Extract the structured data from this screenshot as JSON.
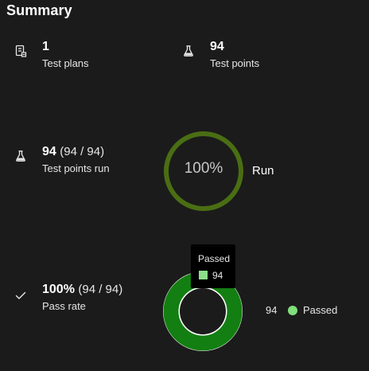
{
  "summary": {
    "title": "Summary",
    "test_plans": {
      "value": "1",
      "label": "Test plans",
      "icon": "test-plan-icon"
    },
    "test_points": {
      "value": "94",
      "label": "Test points",
      "icon": "beaker-icon"
    },
    "test_points_run": {
      "value": "94",
      "detail": "(94 / 94)",
      "label": "Test points run",
      "icon": "beaker-icon"
    },
    "pass_rate": {
      "value": "100%",
      "detail": "(94 / 94)",
      "label": "Pass rate",
      "icon": "checkmark-icon"
    }
  },
  "run_chart": {
    "percent_text": "100%",
    "percent": 100,
    "label": "Run",
    "color": "#4a6e13"
  },
  "pass_chart": {
    "tooltip_title": "Passed",
    "tooltip_value": "94",
    "legend_count": "94",
    "legend_label": "Passed",
    "passed": 94,
    "total": 94,
    "ring_color": "#137f12",
    "legend_color": "#7fe07c"
  }
}
